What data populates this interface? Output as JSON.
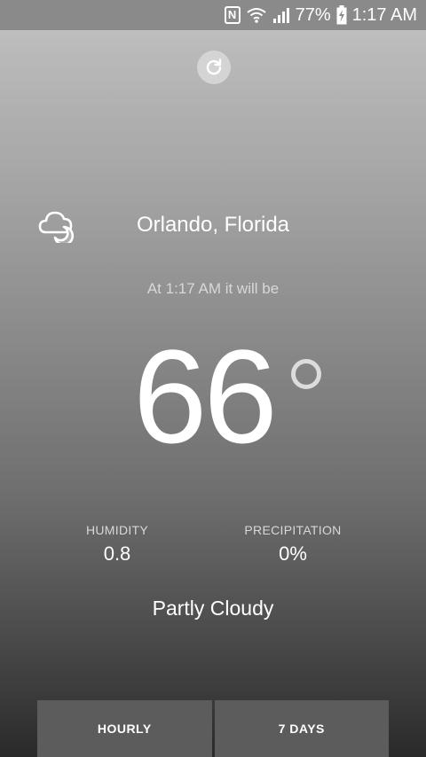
{
  "status_bar": {
    "battery": "77%",
    "time": "1:17 AM",
    "nfc_letter": "N"
  },
  "weather": {
    "location": "Orlando, Florida",
    "subtitle": "At 1:17 AM it will be",
    "temperature": "66",
    "condition": "Partly Cloudy",
    "icon": "partly-cloudy-night-icon"
  },
  "stats": {
    "humidity_label": "HUMIDITY",
    "humidity_value": "0.8",
    "precip_label": "PRECIPITATION",
    "precip_value": "0%"
  },
  "tabs": {
    "hourly": "HOURLY",
    "seven_days": "7 DAYS"
  }
}
